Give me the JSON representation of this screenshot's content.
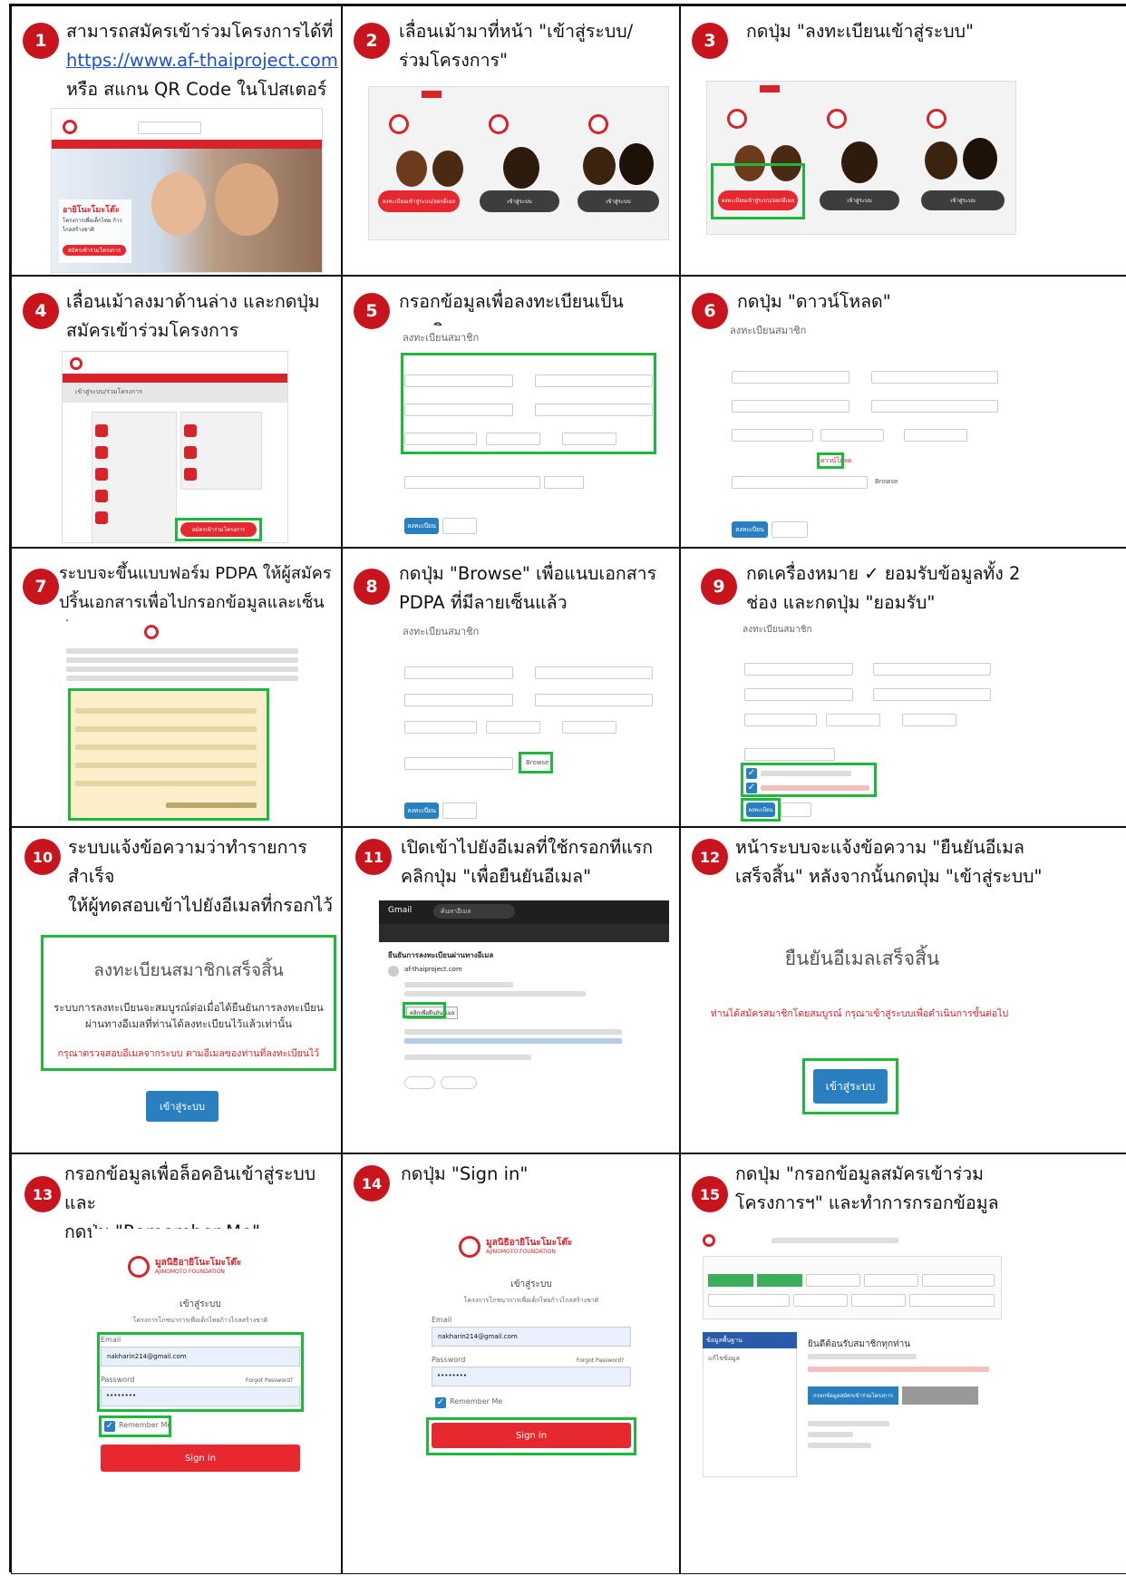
{
  "steps": [
    {
      "num": "1",
      "caption_lines": [
        "สามารถสมัครเข้าร่วมโครงการได้ที่"
      ],
      "link": "https://www.af-thaiproject.com",
      "caption_after": "หรือ สแกน QR Code ในโปสเตอร์"
    },
    {
      "num": "2",
      "caption_lines": [
        "เลื่อนเม้ามาที่หน้า \"เข้าสู่ระบบ/",
        "ร่วมโครงการ\""
      ]
    },
    {
      "num": "3",
      "caption_lines": [
        "กดปุ่ม \"ลงทะเบียนเข้าสู่ระบบ\""
      ]
    },
    {
      "num": "4",
      "caption_lines": [
        "เลื่อนเม้าลงมาด้านล่าง และกดปุ่ม",
        "สมัครเข้าร่วมโครงการ"
      ]
    },
    {
      "num": "5",
      "caption_lines": [
        "กรอกข้อมูลเพื่อลงทะเบียนเป็นสมาชิก"
      ]
    },
    {
      "num": "6",
      "caption_lines": [
        "กดปุ่ม \"ดาวน์โหลด\""
      ]
    },
    {
      "num": "7",
      "caption_lines": [
        "ระบบจะขึ้นแบบฟอร์ม PDPA ให้ผู้สมัคร",
        "ปริ้นเอกสารเพื่อไปกรอกข้อมูลและเซ็นชื่อ"
      ]
    },
    {
      "num": "8",
      "caption_lines": [
        "กดปุ่ม \"Browse\" เพื่อแนบเอกสาร",
        "PDPA ที่มีลายเซ็นแล้ว"
      ]
    },
    {
      "num": "9",
      "caption_lines": [
        "กดเครื่องหมาย ✓ ยอมรับข้อมูลทั้ง 2",
        "ช่อง และกดปุ่ม \"ยอมรับ\""
      ]
    },
    {
      "num": "10",
      "caption_lines": [
        "ระบบแจ้งข้อความว่าทำรายการสำเร็จ",
        "ให้ผู้ทดสอบเข้าไปยังอีเมลที่กรอกไว้"
      ]
    },
    {
      "num": "11",
      "caption_lines": [
        "เปิดเข้าไปยังอีเมลที่ใช้กรอกทีแรก",
        "คลิกปุ่ม \"เพื่อยืนยันอีเมล\""
      ]
    },
    {
      "num": "12",
      "caption_lines": [
        "หน้าระบบจะแจ้งข้อความ \"ยืนยันอีเมล",
        "เสร็จสิ้น\" หลังจากนั้นกดปุ่ม \"เข้าสู่ระบบ\""
      ]
    },
    {
      "num": "13",
      "caption_lines": [
        "กรอกข้อมูลเพื่อล็อคอินเข้าสู่ระบบ และ",
        "กดปุ่ม \"Remember Me\""
      ]
    },
    {
      "num": "14",
      "caption_lines": [
        "กดปุ่ม \"Sign in\""
      ]
    },
    {
      "num": "15",
      "caption_lines": [
        "กดปุ่ม \"กรอกข้อมูลสมัครเข้าร่วม",
        "โครงการฯ\" และทำการกรอกข้อมูล"
      ]
    }
  ],
  "shots": {
    "s1": {
      "hero_title": "อายิโนะโมะโต๊ะ",
      "hero_sub": "โครงการเพื่อเด็กไทย ก้าวไกลสร้างชาติ",
      "hero_btn": "สมัครเข้าร่วมโครงการ"
    },
    "s2": {
      "btn_register": "ลงทะเบียนเข้าสู่ระบบ/ออกอีเมล",
      "btn_login1": "เข้าสู่ระบบ",
      "btn_login2": "เข้าสู่ระบบ"
    },
    "s4": {
      "breadcrumb": "เข้าสู่ระบบ/ร่วมโครงการ",
      "btn_join": "สมัครเข้าร่วมโครงการ"
    },
    "form": {
      "title": "ลงทะเบียนสมาชิก",
      "btn_submit": "ลงทะเบียน",
      "btn_reset": "ล้างข้อมูล",
      "browse": "Browse",
      "download": "ดาวน์โหลด"
    },
    "s10": {
      "title": "ลงทะเบียนสมาชิกเสร็จสิ้น",
      "body1": "ระบบการลงทะเบียนจะสมบูรณ์ต่อเมื่อได้ยืนยันการลงทะเบียน",
      "body2": "ผ่านทางอีเมลที่ท่านได้ลงทะเบียนไว้แล้วเท่านั้น",
      "warn": "กรุณาตรวจสอบอีเมลจากระบบ ตามอีเมลของท่านที่ลงทะเบียนไว้",
      "btn": "เข้าสู่ระบบ"
    },
    "s11": {
      "app": "Gmail",
      "search": "ค้นหาอีเมล",
      "subject": "ยืนยันการลงทะเบียนผ่านทางอีเมล",
      "from": "af-thaiproject.com",
      "btn_confirm": "คลิกเพื่อยืนยันอีเมล"
    },
    "s12": {
      "title": "ยืนยันอีเมลเสร็จสิ้น",
      "msg": "ท่านได้สมัครสมาชิกโดยสมบูรณ์ กรุณาเข้าสู่ระบบเพื่อดำเนินการขั้นต่อไป",
      "btn": "เข้าสู่ระบบ"
    },
    "login": {
      "brand": "มูลนิธิอายิโนะโมะโต๊ะ",
      "brand_en": "AJINOMOTO FOUNDATION",
      "heading": "เข้าสู่ระบบ",
      "sub": "โครงการโภชนาการเพื่อเด็กไทยก้าวไกลสร้างชาติ",
      "email_label": "Email",
      "email_value": "nakharin214@gmail.com",
      "password_label": "Password",
      "password_value": "••••••••",
      "forgot": "Forgot Password?",
      "remember": "Remember Me",
      "sign_in": "Sign in"
    },
    "s15": {
      "tab_main": "ข้อมูลพื้นฐาน",
      "welcome": "ยินดีต้อนรับสมาชิกทุกท่าน",
      "btn_fill": "กรอกข้อมูลสมัครเข้าร่วมโครงการ",
      "side_item": "แก้ไขข้อมูล"
    }
  },
  "colors": {
    "badge": "#c8141c",
    "highlight": "#1db83c",
    "brand_red": "#d8232a",
    "button_blue": "#2a7fc0"
  }
}
